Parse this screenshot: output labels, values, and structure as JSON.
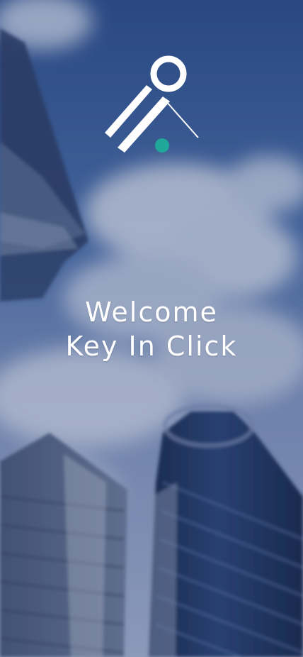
{
  "splash": {
    "welcome_line1": "Welcome",
    "welcome_line2": "Key In Click"
  },
  "logo": {
    "icon": "key-in-click-logo-icon",
    "dot_color": "#1fa89a",
    "line_color": "#ffffff"
  },
  "background": {
    "description_icon": "city-skyscrapers-background",
    "sky_color": "#3b5f9a",
    "cloud_color": "#cdd6e6"
  }
}
